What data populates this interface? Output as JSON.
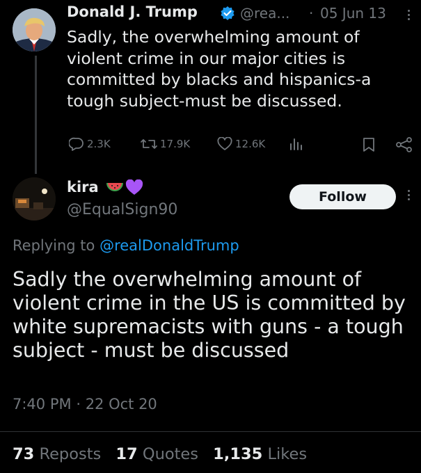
{
  "original_tweet": {
    "author_name": "Donald J. Trump",
    "handle": "@rea...",
    "separator": "·",
    "date": "05 Jun 13",
    "body_lines": [
      "Sadly, the overwhelming amount of",
      "violent crime in our major cities is",
      "committed by blacks and hispanics-a",
      "tough subject-must be discussed."
    ],
    "metrics": {
      "replies": "2.3K",
      "reposts": "17.9K",
      "likes": "12.6K"
    },
    "verified_badge_color": "#1d9bf0"
  },
  "reply_tweet": {
    "author_name": "kira",
    "author_emoji": [
      "watermelon-emoji",
      "purple-heart-emoji"
    ],
    "handle": "@EqualSign90",
    "follow_label": "Follow",
    "replying_to_prefix": "Replying to",
    "replying_to_handle": "@realDonaldTrump",
    "body_lines": [
      "Sadly the overwhelming amount of",
      "violent crime in the US is committed by",
      "white supremacists with guns - a tough",
      "subject - must be discussed"
    ],
    "time": "7:40 PM",
    "separator": "·",
    "date": "22 Oct 20",
    "stats": {
      "reposts_count": "73",
      "reposts_label": "Reposts",
      "quotes_count": "17",
      "quotes_label": "Quotes",
      "likes_count": "1,135",
      "likes_label": "Likes"
    }
  },
  "colors": {
    "background": "#000000",
    "text": "#e7e9ea",
    "muted": "#71767b",
    "link": "#1d9bf0"
  }
}
